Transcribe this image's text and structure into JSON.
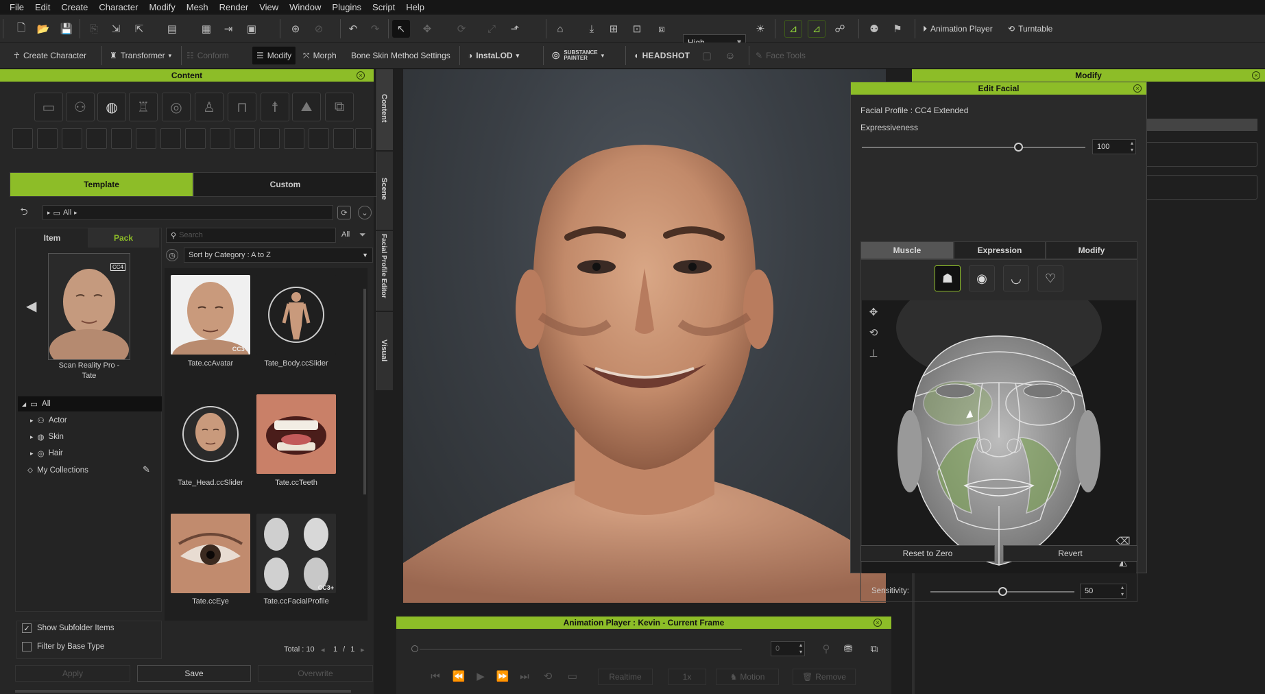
{
  "menu": [
    "File",
    "Edit",
    "Create",
    "Character",
    "Modify",
    "Mesh",
    "Render",
    "View",
    "Window",
    "Plugins",
    "Script",
    "Help"
  ],
  "toolbar1": {
    "quality": "High",
    "animation_player": "Animation Player",
    "turntable": "Turntable"
  },
  "toolbar2": {
    "create_character": "Create Character",
    "transformer": "Transformer",
    "conform": "Conform",
    "modify": "Modify",
    "morph": "Morph",
    "bone_skin": "Bone Skin Method Settings",
    "instalod": "InstaLOD",
    "substance_line1": "SUBSTANCE",
    "substance_line2": "PAINTER",
    "headshot": "HEADSHOT",
    "face_tools": "Face Tools"
  },
  "content": {
    "title": "Content",
    "tabs": [
      "Template",
      "Custom"
    ],
    "path": "All",
    "subtabs": [
      "Item",
      "Pack"
    ],
    "preview_caption_line1": "Scan Reality Pro -",
    "preview_caption_line2": "Tate",
    "preview_badge": "CC4",
    "search_placeholder": "Search",
    "filter_all": "All",
    "sort": "Sort by Category : A to Z",
    "items": [
      {
        "label": "Tate.ccAvatar",
        "badge": "CC3+"
      },
      {
        "label": "Tate_Body.ccSlider"
      },
      {
        "label": "Tate_Head.ccSlider"
      },
      {
        "label": "Tate.ccTeeth"
      },
      {
        "label": "Tate.ccEye"
      },
      {
        "label": "Tate.ccFacialProfile",
        "badge": "CC3+"
      }
    ],
    "tree": [
      "All",
      "Actor",
      "Skin",
      "Hair",
      "My Collections"
    ],
    "show_subfolder": "Show Subfolder Items",
    "filter_base": "Filter by Base Type",
    "total": "Total : 10",
    "page_current": "1",
    "page_sep": "/",
    "page_total": "1",
    "apply": "Apply",
    "save": "Save",
    "overwrite": "Overwrite",
    "side_tabs": [
      "Content",
      "Scene",
      "Facial Profile Editor",
      "Visual"
    ]
  },
  "animation": {
    "title": "Animation Player : Kevin - Current Frame",
    "frame": "0",
    "realtime": "Realtime",
    "speed": "1x",
    "motion": "Motion",
    "remove": "Remove"
  },
  "modify_panel": {
    "title": "Modify"
  },
  "edit_facial": {
    "title": "Edit Facial",
    "profile": "Facial Profile : CC4 Extended",
    "expressiveness_label": "Expressiveness",
    "expressiveness_value": "100",
    "expressiveness_level": 0.7,
    "tabs": [
      "Muscle",
      "Expression",
      "Modify"
    ],
    "sensitivity_label": "Sensitivity:",
    "sensitivity_value": "50",
    "sensitivity_level": 0.5,
    "reset": "Reset to Zero",
    "revert": "Revert"
  }
}
